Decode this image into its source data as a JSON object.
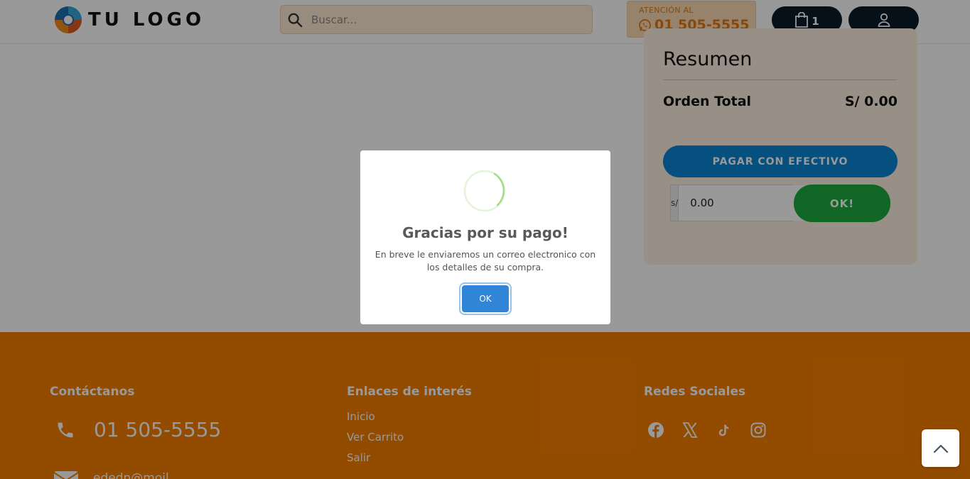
{
  "header": {
    "logo_text": "TU LOGO",
    "search_placeholder": "Buscar...",
    "attention_label": "ATENCIÓN AL",
    "attention_phone": "01 505-5555",
    "cart_count": "1"
  },
  "summary": {
    "title": "Resumen",
    "total_label": "Orden Total",
    "total_value": "S/ 0.00",
    "pay_cash_label": "PAGAR CON EFECTIVO",
    "cash_prefix": "s/",
    "cash_value": "0.00",
    "ok_label": "OK!"
  },
  "footer": {
    "contact_heading": "Contáctanos",
    "contact_phone": "01 505-5555",
    "contact_email_partial": "ededn@moil",
    "links_heading": "Enlaces de interés",
    "links": [
      "Inicio",
      "Ver Carrito",
      "Salir"
    ],
    "social_heading": "Redes Sociales",
    "social_icons": [
      "facebook-icon",
      "x-icon",
      "tiktok-icon",
      "instagram-icon"
    ]
  },
  "modal": {
    "title": "Gracias por su pago!",
    "text": "En breve le enviaremos un correo electronico con los detalles de su compra.",
    "ok_label": "OK"
  },
  "colors": {
    "accent_orange": "#f57e01",
    "dark_navy": "#0a1b2a",
    "pay_blue": "#0b86d6",
    "ok_green": "#1faa3f",
    "modal_button": "#3085d6"
  }
}
